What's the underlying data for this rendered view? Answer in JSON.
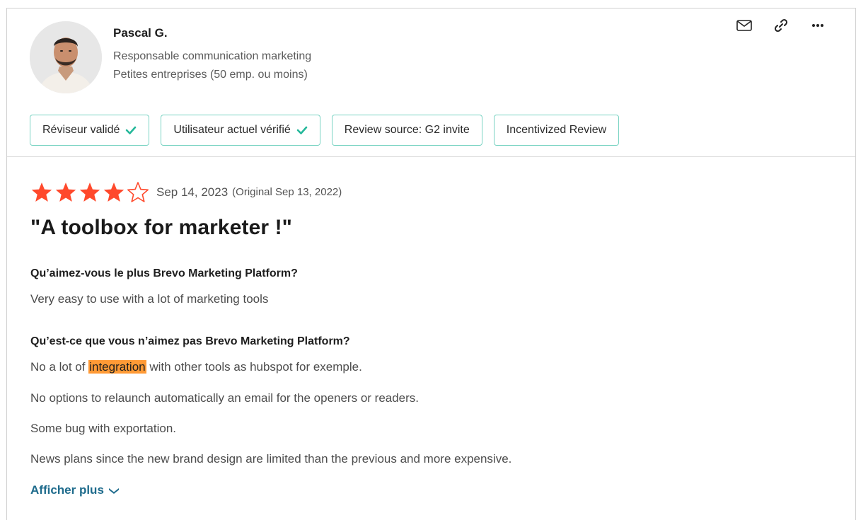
{
  "reviewer": {
    "name": "Pascal G.",
    "role": "Responsable communication marketing",
    "segment": "Petites entreprises (50 emp. ou moins)"
  },
  "actions": [
    {
      "icon": "mail-icon"
    },
    {
      "icon": "link-icon"
    },
    {
      "icon": "more-icon"
    }
  ],
  "badges": [
    {
      "label": "Réviseur validé",
      "check": true
    },
    {
      "label": "Utilisateur actuel vérifié",
      "check": true
    },
    {
      "label": "Review source: G2 invite",
      "check": false
    },
    {
      "label": "Incentivized Review",
      "check": false
    }
  ],
  "review": {
    "rating": 4,
    "rating_max": 5,
    "date": "Sep 14, 2023",
    "original_date": "(Original Sep 13, 2022)",
    "title": "\"A toolbox for marketer !\"",
    "q1": "Qu’aimez-vous le plus Brevo Marketing Platform?",
    "a1": "Very easy to use with a lot of marketing tools",
    "q2": "Qu’est-ce que vous n’aimez pas Brevo Marketing Platform?",
    "a2_pre": "No a lot of ",
    "a2_highlight": "integration",
    "a2_post": " with other tools as hubspot for exemple.",
    "a3": "No options to relaunch automatically an email for the openers or readers.",
    "a4": "Some bug with exportation.",
    "a5": "News plans since the new brand design are limited than the previous and more expensive.",
    "show_more": "Afficher plus"
  },
  "colors": {
    "star": "#ff492c",
    "badge_border": "#79d3c3",
    "check": "#25b89a",
    "highlight": "#ff9a36",
    "link": "#1e6b8c"
  }
}
